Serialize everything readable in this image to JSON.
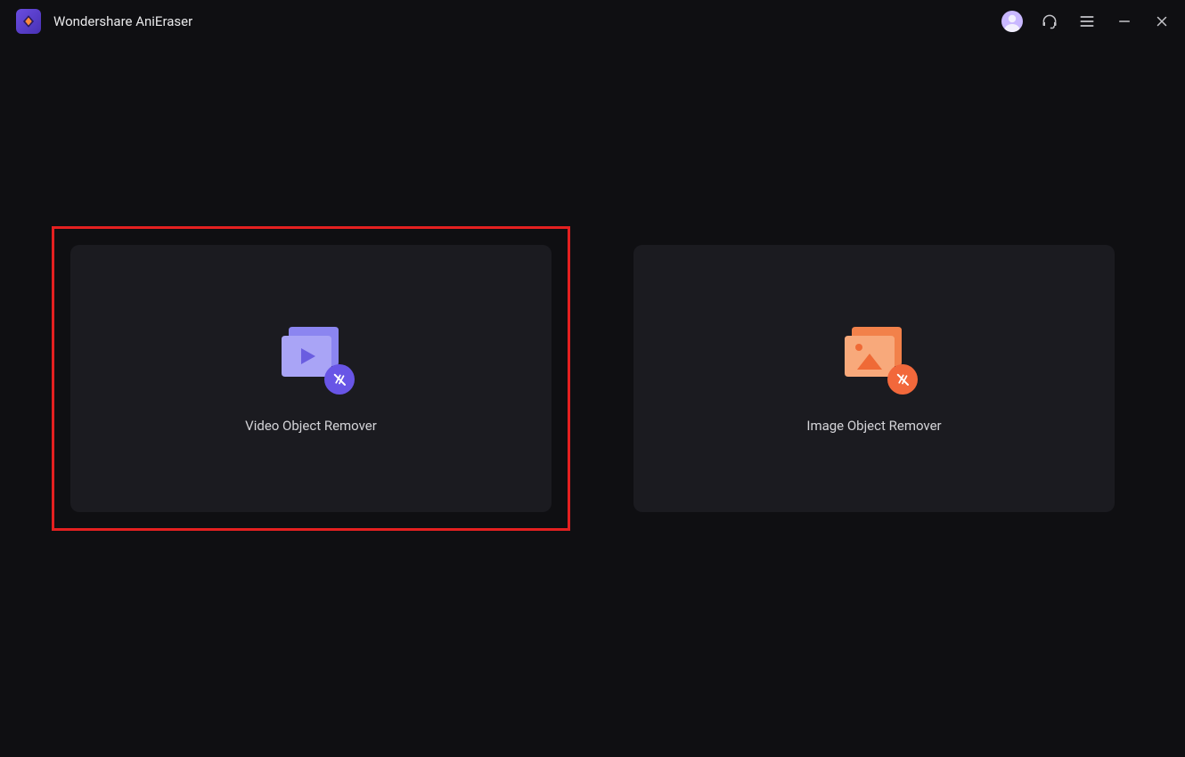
{
  "app": {
    "title": "Wondershare AniEraser"
  },
  "cards": {
    "video": {
      "label": "Video Object Remover",
      "highlighted": true
    },
    "image": {
      "label": "Image Object Remover",
      "highlighted": false
    }
  },
  "colors": {
    "highlight": "#e42020",
    "video_accent": "#8b85f0",
    "image_accent": "#f28a54"
  }
}
